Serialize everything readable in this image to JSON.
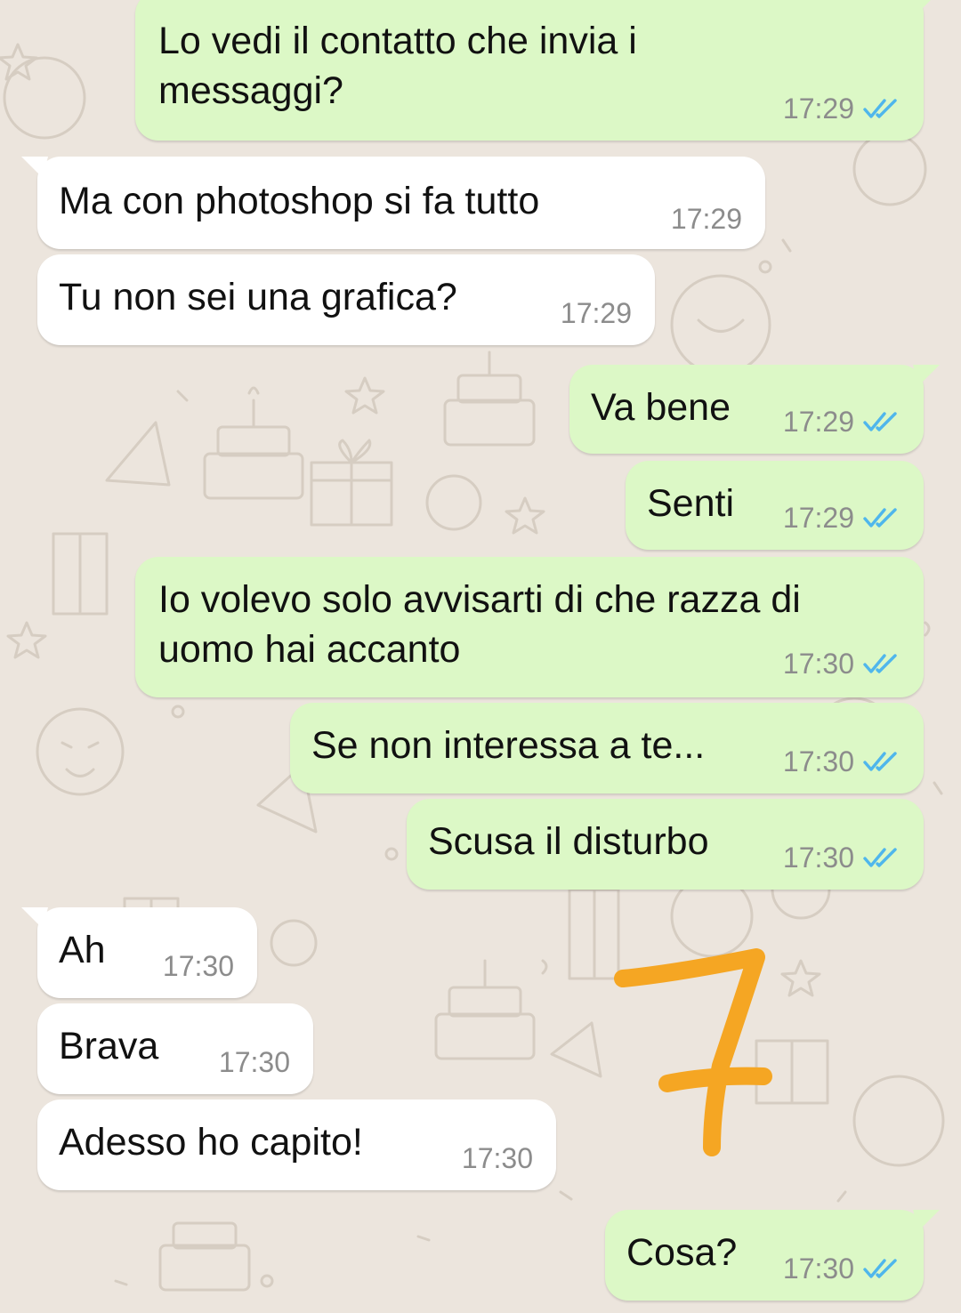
{
  "colors": {
    "background": "#ece5dd",
    "outgoing_bubble": "#dcf8c6",
    "incoming_bubble": "#ffffff",
    "read_ticks": "#4fb6ec",
    "timestamp": "#8c8c8c",
    "annotation_stroke": "#f5a623"
  },
  "icons": {
    "read_receipt": "double-check-icon",
    "annotation": "handwritten-seven"
  },
  "messages": [
    {
      "direction": "outgoing",
      "lines": [
        "Lo vedi il contatto che invia i",
        "messaggi?"
      ],
      "time": "17:29",
      "read": true
    },
    {
      "direction": "incoming",
      "lines": [
        "Ma con photoshop si fa tutto"
      ],
      "time": "17:29"
    },
    {
      "direction": "incoming",
      "lines": [
        "Tu non sei una grafica?"
      ],
      "time": "17:29"
    },
    {
      "direction": "outgoing",
      "lines": [
        "Va bene"
      ],
      "time": "17:29",
      "read": true
    },
    {
      "direction": "outgoing",
      "lines": [
        "Senti"
      ],
      "time": "17:29",
      "read": true
    },
    {
      "direction": "outgoing",
      "lines": [
        "Io volevo solo avvisarti di che razza di",
        "uomo hai accanto"
      ],
      "time": "17:30",
      "read": true
    },
    {
      "direction": "outgoing",
      "lines": [
        "Se non interessa a te..."
      ],
      "time": "17:30",
      "read": true
    },
    {
      "direction": "outgoing",
      "lines": [
        "Scusa il disturbo"
      ],
      "time": "17:30",
      "read": true
    },
    {
      "direction": "incoming",
      "lines": [
        "Ah"
      ],
      "time": "17:30"
    },
    {
      "direction": "incoming",
      "lines": [
        "Brava"
      ],
      "time": "17:30"
    },
    {
      "direction": "incoming",
      "lines": [
        "Adesso ho capito!"
      ],
      "time": "17:30"
    },
    {
      "direction": "outgoing",
      "lines": [
        "Cosa?"
      ],
      "time": "17:30",
      "read": true
    }
  ]
}
